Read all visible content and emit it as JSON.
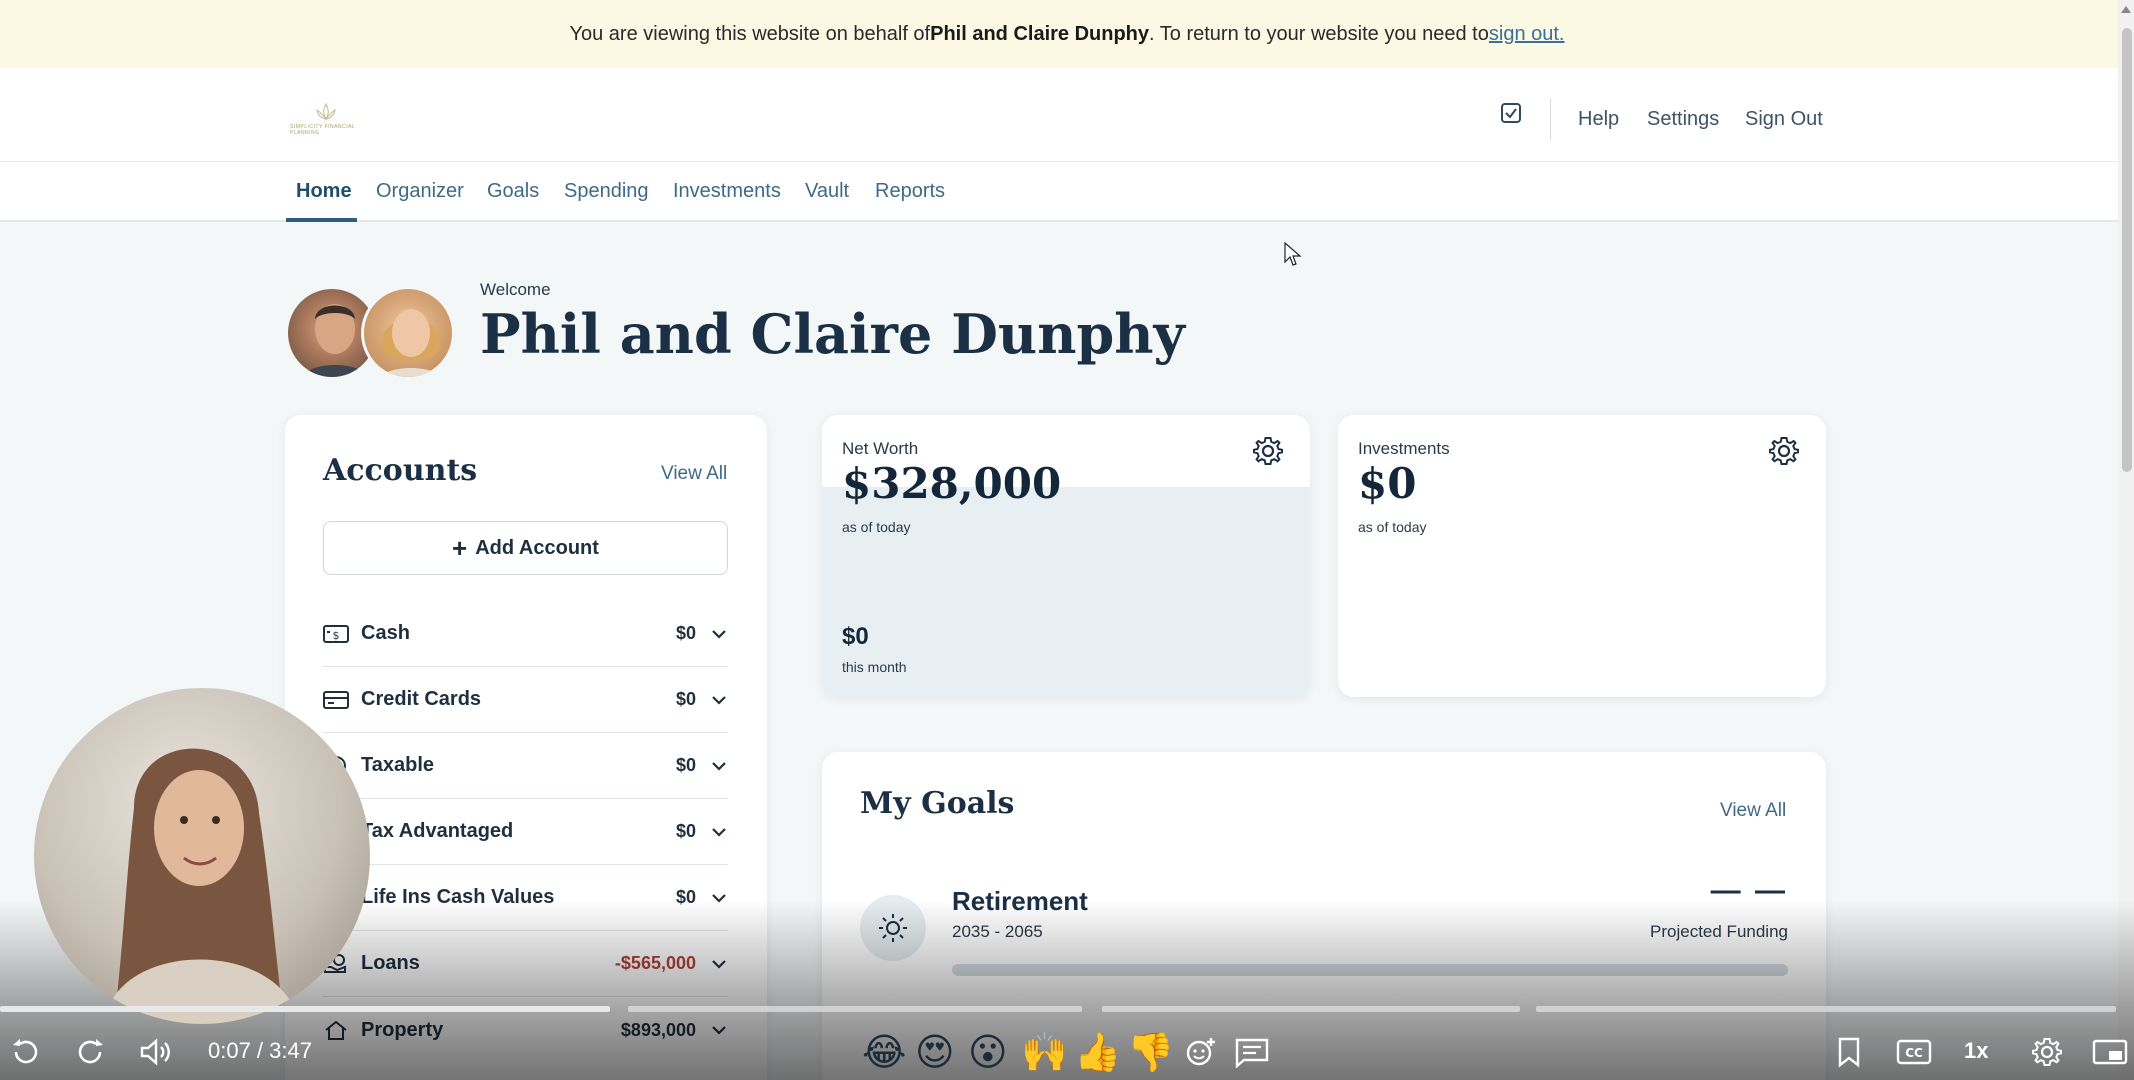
{
  "banner": {
    "prefix": "You are viewing this website on behalf of ",
    "name": "Phil and Claire Dunphy",
    "middle": ". To return to your website you need to ",
    "link": "sign out."
  },
  "header": {
    "logo_text": "SIMPLICITY FINANCIAL PLANNING",
    "links": [
      "Help",
      "Settings",
      "Sign Out"
    ]
  },
  "nav": {
    "items": [
      "Home",
      "Organizer",
      "Goals",
      "Spending",
      "Investments",
      "Vault",
      "Reports"
    ],
    "active": "Home"
  },
  "welcome": {
    "label": "Welcome",
    "name": "Phil and Claire Dunphy"
  },
  "accounts": {
    "title": "Accounts",
    "view_all": "View All",
    "add_label": "Add Account",
    "rows": [
      {
        "label": "Cash",
        "value": "$0",
        "icon": "cash-icon"
      },
      {
        "label": "Credit Cards",
        "value": "$0",
        "icon": "credit-card-icon"
      },
      {
        "label": "Taxable",
        "value": "$0",
        "icon": "taxable-icon"
      },
      {
        "label": "Tax Advantaged",
        "value": "$0",
        "icon": "tax-advantaged-icon"
      },
      {
        "label": "Life Ins Cash Values",
        "value": "$0",
        "icon": "life-insurance-icon"
      },
      {
        "label": "Loans",
        "value": "-$565,000",
        "icon": "loans-icon"
      },
      {
        "label": "Property",
        "value": "$893,000",
        "icon": "property-icon"
      }
    ]
  },
  "net_worth": {
    "label": "Net Worth",
    "value": "$328,000",
    "as_of": "as of today",
    "month_value": "$0",
    "month_label": "this month"
  },
  "investments": {
    "label": "Investments",
    "value": "$0",
    "as_of": "as of today"
  },
  "goals": {
    "title": "My Goals",
    "view_all": "View All",
    "items": [
      {
        "name": "Retirement",
        "years": "2035 - 2065",
        "funding": "— —",
        "funding_label": "Projected Funding"
      }
    ]
  },
  "video": {
    "time": "0:07 / 3:47",
    "speed": "1x",
    "emojis": [
      "😂",
      "😍",
      "😮",
      "🙌",
      "👍",
      "👎"
    ]
  },
  "colors": {
    "accent": "#2f5e7e",
    "negative": "#b0413b",
    "banner_bg": "#fbf8e4"
  }
}
